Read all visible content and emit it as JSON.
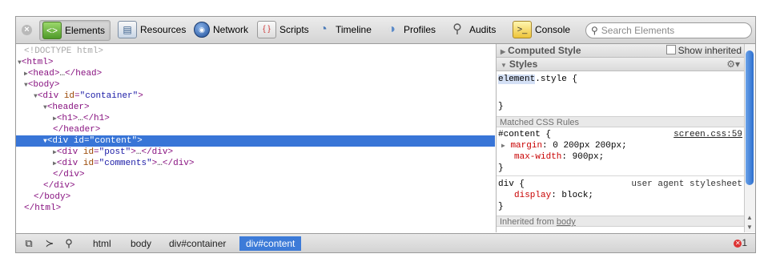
{
  "toolbar": {
    "tabs": [
      {
        "label": "Elements",
        "icon": "elements-icon"
      },
      {
        "label": "Resources",
        "icon": "resources-icon"
      },
      {
        "label": "Network",
        "icon": "network-icon"
      },
      {
        "label": "Scripts",
        "icon": "scripts-icon"
      },
      {
        "label": "Timeline",
        "icon": "timeline-icon"
      },
      {
        "label": "Profiles",
        "icon": "profiles-icon"
      },
      {
        "label": "Audits",
        "icon": "audits-icon"
      },
      {
        "label": "Console",
        "icon": "console-icon"
      }
    ],
    "active_tab": "Elements",
    "search_placeholder": "Search Elements"
  },
  "dom_tree": {
    "doctype": "<!DOCTYPE html>",
    "html_open": "<html>",
    "head": "<head>",
    "head_ellipsis": "…",
    "head_close": "</head>",
    "body_open": "<body>",
    "container_tag": "<div ",
    "container_attr": "id",
    "container_val": "\"container\"",
    "container_end": ">",
    "header_open": "<header>",
    "h1": "<h1>",
    "h1_ellipsis": "…",
    "h1_close": "</h1>",
    "header_close": "</header>",
    "content_tag": "<div ",
    "content_attr": "id",
    "content_val": "\"content\"",
    "content_end": ">",
    "post_tag": "<div ",
    "post_attr": "id",
    "post_val": "\"post\"",
    "post_end": ">",
    "post_ellipsis": "…",
    "post_close": "</div>",
    "comments_tag": "<div ",
    "comments_attr": "id",
    "comments_val": "\"comments\"",
    "comments_end": ">",
    "comments_ellipsis": "…",
    "comments_close": "</div>",
    "div_close_1": "</div>",
    "div_close_2": "</div>",
    "body_close": "</body>",
    "html_close": "</html>"
  },
  "styles": {
    "computed_header": "Computed Style",
    "show_inherited": "Show inherited",
    "styles_header": "Styles",
    "element_style_sel": "element",
    "element_style_rest": ".style {",
    "element_style_close": "}",
    "matched_rules": "Matched CSS Rules",
    "rule1_selector": "#content {",
    "rule1_source": "screen.css:59",
    "rule1_prop1": "margin",
    "rule1_val1": ": 0 200px 200px;",
    "rule1_prop2": "max-width",
    "rule1_val2": ": 900px;",
    "rule1_close": "}",
    "rule2_selector": "div {",
    "rule2_source": "user agent stylesheet",
    "rule2_prop1": "display",
    "rule2_val1": ": block;",
    "rule2_close": "}",
    "inherited_prefix": "Inherited from ",
    "inherited_link": "body"
  },
  "statusbar": {
    "breadcrumbs": [
      "html",
      "body",
      "div#container",
      "div#content"
    ],
    "error_count": "1"
  }
}
